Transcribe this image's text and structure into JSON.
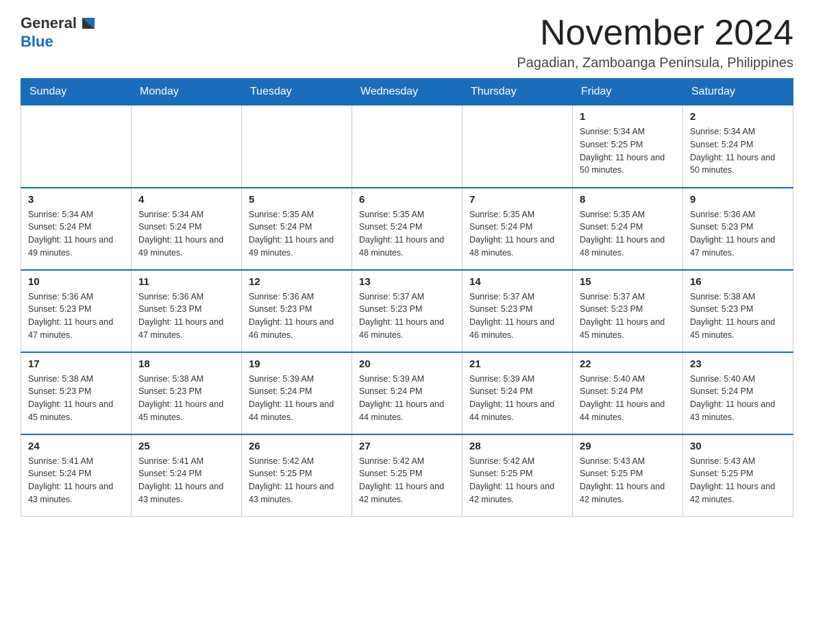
{
  "header": {
    "logo_general": "General",
    "logo_blue": "Blue",
    "month_title": "November 2024",
    "subtitle": "Pagadian, Zamboanga Peninsula, Philippines"
  },
  "days_of_week": [
    "Sunday",
    "Monday",
    "Tuesday",
    "Wednesday",
    "Thursday",
    "Friday",
    "Saturday"
  ],
  "weeks": [
    [
      {
        "day": "",
        "info": ""
      },
      {
        "day": "",
        "info": ""
      },
      {
        "day": "",
        "info": ""
      },
      {
        "day": "",
        "info": ""
      },
      {
        "day": "",
        "info": ""
      },
      {
        "day": "1",
        "info": "Sunrise: 5:34 AM\nSunset: 5:25 PM\nDaylight: 11 hours and 50 minutes."
      },
      {
        "day": "2",
        "info": "Sunrise: 5:34 AM\nSunset: 5:24 PM\nDaylight: 11 hours and 50 minutes."
      }
    ],
    [
      {
        "day": "3",
        "info": "Sunrise: 5:34 AM\nSunset: 5:24 PM\nDaylight: 11 hours and 49 minutes."
      },
      {
        "day": "4",
        "info": "Sunrise: 5:34 AM\nSunset: 5:24 PM\nDaylight: 11 hours and 49 minutes."
      },
      {
        "day": "5",
        "info": "Sunrise: 5:35 AM\nSunset: 5:24 PM\nDaylight: 11 hours and 49 minutes."
      },
      {
        "day": "6",
        "info": "Sunrise: 5:35 AM\nSunset: 5:24 PM\nDaylight: 11 hours and 48 minutes."
      },
      {
        "day": "7",
        "info": "Sunrise: 5:35 AM\nSunset: 5:24 PM\nDaylight: 11 hours and 48 minutes."
      },
      {
        "day": "8",
        "info": "Sunrise: 5:35 AM\nSunset: 5:24 PM\nDaylight: 11 hours and 48 minutes."
      },
      {
        "day": "9",
        "info": "Sunrise: 5:36 AM\nSunset: 5:23 PM\nDaylight: 11 hours and 47 minutes."
      }
    ],
    [
      {
        "day": "10",
        "info": "Sunrise: 5:36 AM\nSunset: 5:23 PM\nDaylight: 11 hours and 47 minutes."
      },
      {
        "day": "11",
        "info": "Sunrise: 5:36 AM\nSunset: 5:23 PM\nDaylight: 11 hours and 47 minutes."
      },
      {
        "day": "12",
        "info": "Sunrise: 5:36 AM\nSunset: 5:23 PM\nDaylight: 11 hours and 46 minutes."
      },
      {
        "day": "13",
        "info": "Sunrise: 5:37 AM\nSunset: 5:23 PM\nDaylight: 11 hours and 46 minutes."
      },
      {
        "day": "14",
        "info": "Sunrise: 5:37 AM\nSunset: 5:23 PM\nDaylight: 11 hours and 46 minutes."
      },
      {
        "day": "15",
        "info": "Sunrise: 5:37 AM\nSunset: 5:23 PM\nDaylight: 11 hours and 45 minutes."
      },
      {
        "day": "16",
        "info": "Sunrise: 5:38 AM\nSunset: 5:23 PM\nDaylight: 11 hours and 45 minutes."
      }
    ],
    [
      {
        "day": "17",
        "info": "Sunrise: 5:38 AM\nSunset: 5:23 PM\nDaylight: 11 hours and 45 minutes."
      },
      {
        "day": "18",
        "info": "Sunrise: 5:38 AM\nSunset: 5:23 PM\nDaylight: 11 hours and 45 minutes."
      },
      {
        "day": "19",
        "info": "Sunrise: 5:39 AM\nSunset: 5:24 PM\nDaylight: 11 hours and 44 minutes."
      },
      {
        "day": "20",
        "info": "Sunrise: 5:39 AM\nSunset: 5:24 PM\nDaylight: 11 hours and 44 minutes."
      },
      {
        "day": "21",
        "info": "Sunrise: 5:39 AM\nSunset: 5:24 PM\nDaylight: 11 hours and 44 minutes."
      },
      {
        "day": "22",
        "info": "Sunrise: 5:40 AM\nSunset: 5:24 PM\nDaylight: 11 hours and 44 minutes."
      },
      {
        "day": "23",
        "info": "Sunrise: 5:40 AM\nSunset: 5:24 PM\nDaylight: 11 hours and 43 minutes."
      }
    ],
    [
      {
        "day": "24",
        "info": "Sunrise: 5:41 AM\nSunset: 5:24 PM\nDaylight: 11 hours and 43 minutes."
      },
      {
        "day": "25",
        "info": "Sunrise: 5:41 AM\nSunset: 5:24 PM\nDaylight: 11 hours and 43 minutes."
      },
      {
        "day": "26",
        "info": "Sunrise: 5:42 AM\nSunset: 5:25 PM\nDaylight: 11 hours and 43 minutes."
      },
      {
        "day": "27",
        "info": "Sunrise: 5:42 AM\nSunset: 5:25 PM\nDaylight: 11 hours and 42 minutes."
      },
      {
        "day": "28",
        "info": "Sunrise: 5:42 AM\nSunset: 5:25 PM\nDaylight: 11 hours and 42 minutes."
      },
      {
        "day": "29",
        "info": "Sunrise: 5:43 AM\nSunset: 5:25 PM\nDaylight: 11 hours and 42 minutes."
      },
      {
        "day": "30",
        "info": "Sunrise: 5:43 AM\nSunset: 5:25 PM\nDaylight: 11 hours and 42 minutes."
      }
    ]
  ]
}
